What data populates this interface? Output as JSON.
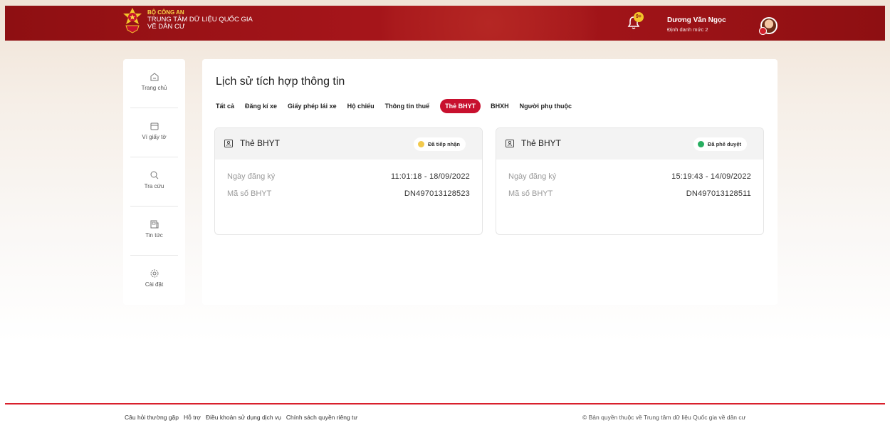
{
  "header": {
    "org_line1": "BỘ CÔNG AN",
    "org_line2": "TRUNG TÂM DỮ LIỆU QUỐC GIA",
    "org_line3": "VỀ DÂN CƯ",
    "notification_badge": "9+",
    "user_name": "Dương Văn Ngọc",
    "user_role": "Định danh mức 2",
    "brand_color": "#a5151a"
  },
  "sidebar": {
    "items": [
      {
        "label": "Trang chủ",
        "icon": "home-icon"
      },
      {
        "label": "Ví giấy tờ",
        "icon": "wallet-icon"
      },
      {
        "label": "Tra cứu",
        "icon": "search-icon"
      },
      {
        "label": "Tin tức",
        "icon": "news-icon"
      },
      {
        "label": "Cài đặt",
        "icon": "settings-icon"
      }
    ]
  },
  "main": {
    "title": "Lịch sử tích hợp thông tin",
    "tabs": [
      {
        "label": "Tất cả"
      },
      {
        "label": "Đăng kí xe"
      },
      {
        "label": "Giấy phép lái xe"
      },
      {
        "label": "Hộ chiếu"
      },
      {
        "label": "Thông tin thuế"
      },
      {
        "label": "Thẻ BHYT",
        "active": true
      },
      {
        "label": "BHXH"
      },
      {
        "label": "Người phụ thuộc"
      }
    ],
    "cards": [
      {
        "title": "Thẻ BHYT",
        "status": "Đã tiếp nhận",
        "status_color": "#f2c94c",
        "rows": [
          {
            "key": "Ngày đăng ký",
            "value": "11:01:18 - 18/09/2022"
          },
          {
            "key": "Mã số BHYT",
            "value": "DN497013128523"
          }
        ]
      },
      {
        "title": "Thẻ BHYT",
        "status": "Đã phê duyệt",
        "status_color": "#27ae60",
        "rows": [
          {
            "key": "Ngày đăng ký",
            "value": "15:19:43 - 14/09/2022"
          },
          {
            "key": "Mã số BHYT",
            "value": "DN497013128511"
          }
        ]
      }
    ]
  },
  "footer": {
    "links": [
      "Câu hỏi thường gặp",
      "Hỗ trợ",
      "Điều khoản sử dụng dịch vụ",
      "Chính sách quyền riêng tư"
    ],
    "copyright": "© Bản quyền thuộc về Trung tâm dữ liệu Quốc gia về dân cư"
  }
}
